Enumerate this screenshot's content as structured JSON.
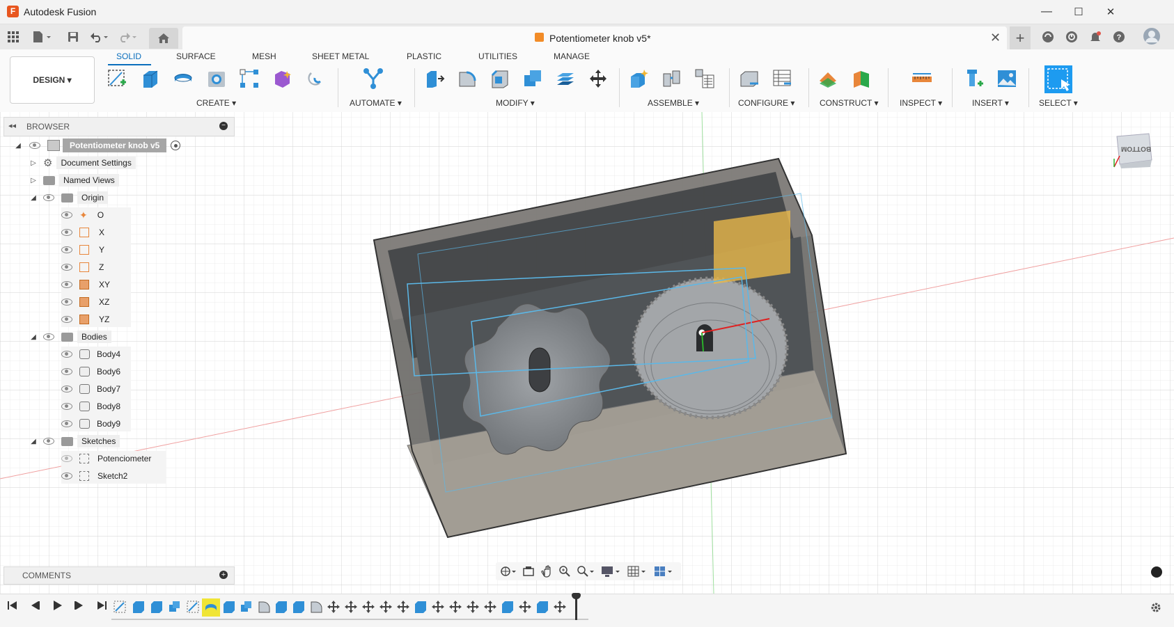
{
  "window": {
    "app_title": "Autodesk Fusion",
    "minimize": "—",
    "maximize": "☐",
    "close": "✕"
  },
  "document_tab": {
    "title": "Potentiometer knob v5*",
    "close": "✕"
  },
  "workspace_button": {
    "label": "DESIGN ▾"
  },
  "ribbon_tabs": [
    "SOLID",
    "SURFACE",
    "MESH",
    "SHEET METAL",
    "PLASTIC",
    "UTILITIES",
    "MANAGE"
  ],
  "ribbon_groups": [
    "CREATE ▾",
    "AUTOMATE ▾",
    "MODIFY ▾",
    "ASSEMBLE ▾",
    "CONFIGURE ▾",
    "CONSTRUCT ▾",
    "INSPECT ▾",
    "INSERT ▾",
    "SELECT ▾"
  ],
  "browser": {
    "title": "BROWSER",
    "root": "Potentiometer knob v5",
    "items": {
      "document_settings": "Document Settings",
      "named_views": "Named Views",
      "origin": "Origin",
      "origin_children": [
        "O",
        "X",
        "Y",
        "Z",
        "XY",
        "XZ",
        "YZ"
      ],
      "bodies": "Bodies",
      "bodies_children": [
        "Body4",
        "Body6",
        "Body7",
        "Body8",
        "Body9"
      ],
      "sketches": "Sketches",
      "sketches_children": [
        "Potenciometer",
        "Sketch2"
      ]
    }
  },
  "comments": {
    "title": "COMMENTS"
  },
  "viewcube": {
    "face_label": "BOTTOM"
  },
  "colors": {
    "accent": "#0a6ebd",
    "ribbon_blue": "#2f8fd6",
    "orange": "#e8863a",
    "select_blue": "#1d9bf0"
  }
}
